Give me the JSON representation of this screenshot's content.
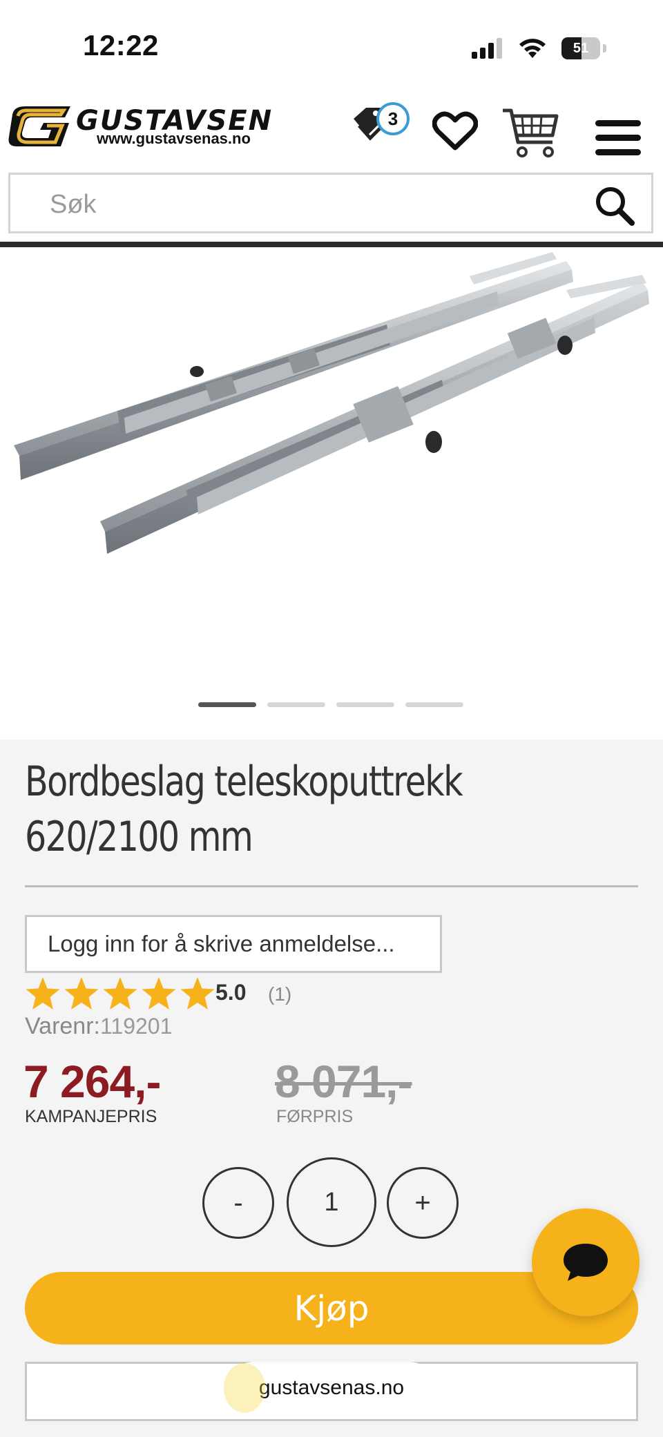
{
  "status": {
    "time": "12:22",
    "battery": "51"
  },
  "header": {
    "logo_text": "GUSTAVSEN",
    "logo_url": "www.gustavsenas.no",
    "offers_count": "3"
  },
  "search": {
    "placeholder": "Søk"
  },
  "gallery": {
    "slide_count": 4,
    "active_slide": 1
  },
  "product": {
    "title": "Bordbeslag teleskoputtrekk 620/2100 mm",
    "review_button": "Logg inn for å skrive anmeldelse...",
    "rating": "5.0",
    "rating_count": "(1)",
    "rating_stars": 5,
    "sku_label": "Varenr:",
    "sku": "119201",
    "price": "7 264,-",
    "price_label": "KAMPANJEPRIS",
    "old_price": "8 071,-",
    "old_price_label": "FØRPRIS",
    "qty_minus": "-",
    "qty_value": "1",
    "qty_plus": "+",
    "buy_label": "Kjøp"
  },
  "browser": {
    "url": "gustavsenas.no"
  },
  "colors": {
    "accent": "#f6b21a",
    "price": "#8c1c22",
    "badge_ring": "#3a9bd5"
  }
}
